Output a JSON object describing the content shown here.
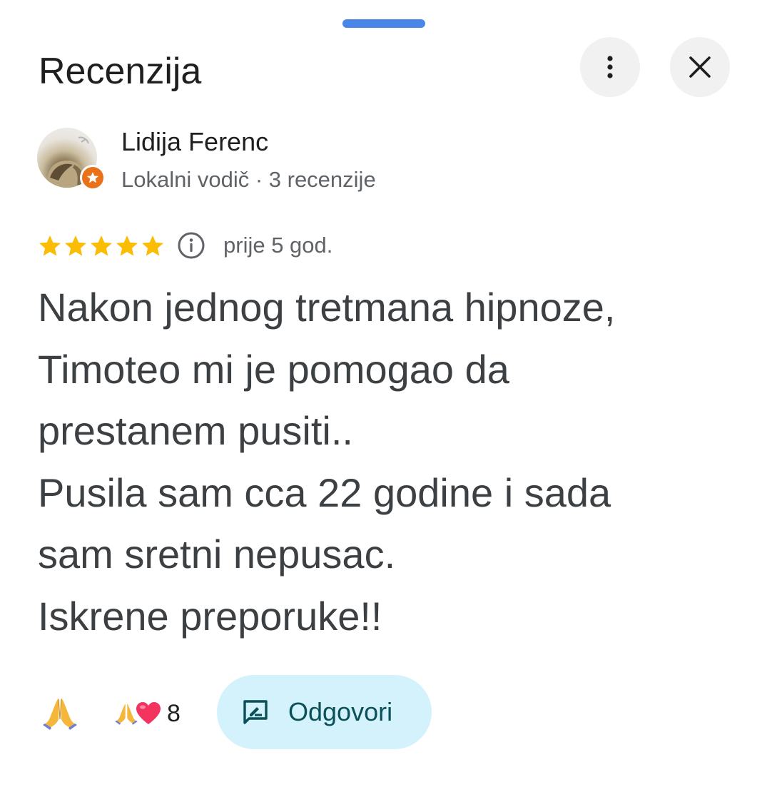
{
  "header": {
    "title": "Recenzija",
    "more_icon": "more-vert-icon",
    "close_icon": "close-icon"
  },
  "reviewer": {
    "name": "Lidija Ferenc",
    "meta": "Lokalni vodič · 3 recenzije",
    "badge_icon": "local-guide-star-icon",
    "badge_color": "#e8711a"
  },
  "rating": {
    "stars": 5,
    "max_stars": 5,
    "star_color": "#fbbc04",
    "info_icon": "info-icon",
    "time": "prije 5 god."
  },
  "review": {
    "lines": [
      "Nakon jednog tretmana hipnoze,",
      "Timoteo mi je pomogao da",
      "prestanem pusiti..",
      "Pusila sam cca 22 godine i sada",
      "sam sretni nepusac.",
      "Iskrene preporuke!!"
    ]
  },
  "reactions": {
    "single_icon": "folded-hands-icon",
    "combo_icons": [
      "folded-hands-icon",
      "heart-icon"
    ],
    "count": "8"
  },
  "reply": {
    "label": "Odgovori",
    "icon": "reply-comment-icon",
    "bg_color": "#d3f2fb",
    "text_color": "#0b4f58"
  },
  "accent": {
    "handle_color": "#4a86e8"
  }
}
